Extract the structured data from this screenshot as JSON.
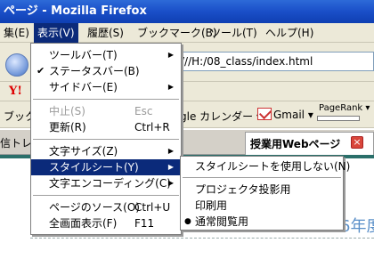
{
  "window": {
    "title": "ページ - Mozilla Firefox"
  },
  "menubar": {
    "items": [
      "集(E)",
      "表示(V)",
      "履歴(S)",
      "ブックマーク(B)",
      "ツール(T)",
      "ヘルプ(H)"
    ]
  },
  "toolbar": {
    "url": "///H:/08_class/index.html",
    "bookmark_left": "ブックマ",
    "calendar": "gle カレンダー ▾",
    "gmail": "Gmail ▾",
    "pagerank": "PageRank ▾"
  },
  "tabs": {
    "left_label": "信トレ",
    "active_label": "授業用Webページ"
  },
  "content": {
    "year_text": "6年度"
  },
  "view_menu": {
    "items": [
      {
        "label": "ツールバー(T)",
        "arrow": "▶"
      },
      {
        "label": "ステータスバー(B)",
        "check": "✔"
      },
      {
        "label": "サイドバー(E)",
        "arrow": "▶"
      },
      {
        "label": "中止(S)",
        "accel": "Esc"
      },
      {
        "label": "更新(R)",
        "accel": "Ctrl+R"
      },
      {
        "label": "文字サイズ(Z)",
        "arrow": "▶"
      },
      {
        "label": "スタイルシート(Y)",
        "arrow": "▶"
      },
      {
        "label": "文字エンコーディング(C)",
        "arrow": "▶"
      },
      {
        "label": "ページのソース(O)",
        "accel": "Ctrl+U"
      },
      {
        "label": "全画面表示(F)",
        "accel": "F11"
      }
    ]
  },
  "stylesheet_submenu": {
    "items": [
      {
        "label": "スタイルシートを使用しない(N)"
      },
      {
        "label": "プロジェクタ投影用"
      },
      {
        "label": "印刷用"
      },
      {
        "label": "通常閲覧用",
        "bullet": "●"
      }
    ]
  },
  "colors": {
    "highlight": "#0b2a7a",
    "titlebar": "#1a4fc8",
    "menubar_bg": "#ece9d8"
  }
}
